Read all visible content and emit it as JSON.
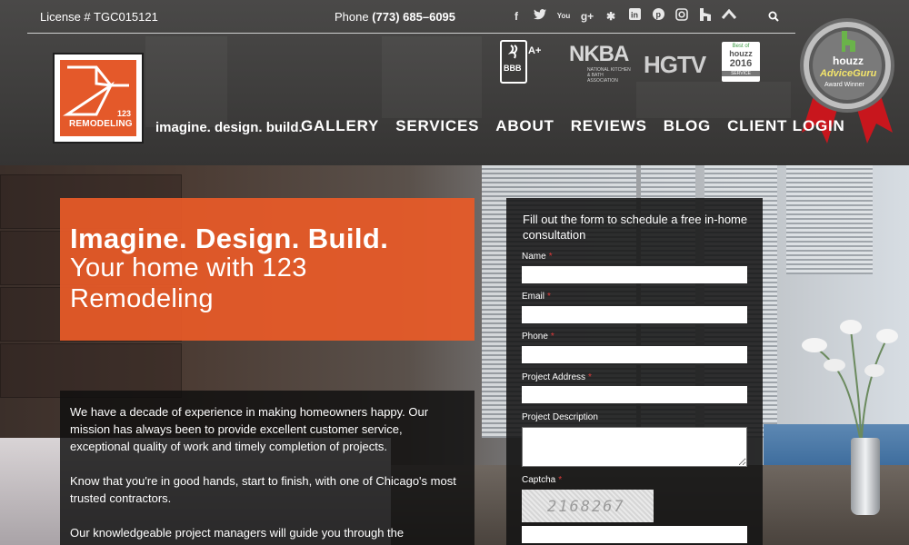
{
  "header": {
    "license": "License # TGC015121",
    "phone_label": "Phone",
    "phone_number": "(773) 685–6095",
    "social_icons": [
      "facebook-icon",
      "twitter-icon",
      "youtube-icon",
      "google-plus-icon",
      "yelp-icon",
      "linkedin-icon",
      "pinterest-icon",
      "instagram-icon",
      "houzz-icon",
      "angies-list-icon"
    ],
    "tagline": "imagine. design. build.",
    "logo": {
      "number": "123",
      "name": "REMODELING"
    },
    "nav": [
      "GALLERY",
      "SERVICES",
      "ABOUT",
      "REVIEWS",
      "BLOG",
      "CLIENT LOGIN"
    ],
    "badges": {
      "bbb": "BBB",
      "bbb_rating": "A+",
      "nkba": "NKBA",
      "nkba_sub": "NATIONAL KITCHEN & BATH ASSOCIATION",
      "hgtv": "HGTV",
      "houzz_best_of": "Best of",
      "houzz_brand": "houzz",
      "houzz_year": "2016",
      "houzz_service": "SERVICE"
    },
    "award": {
      "brand": "houzz",
      "title": "AdviceGuru",
      "subtitle": "Award Winner"
    }
  },
  "hero": {
    "headline_bold": "Imagine. Design. Build.",
    "headline_rest": "Your home with 123 Remodeling"
  },
  "about": {
    "p1": "We have a decade of experience in making homeowners happy. Our mission has always been to provide excellent customer service, exceptional quality of work and timely completion of projects.",
    "p2": "Know that you're in good hands, start to finish, with one of Chicago's most trusted contractors.",
    "p3": "Our knowledgeable project managers will guide you through the complicated process of remodeling your home."
  },
  "form": {
    "intro": "Fill out the form to schedule a free in-home consultation",
    "required_mark": "*",
    "fields": {
      "name": "Name",
      "email": "Email",
      "phone": "Phone",
      "project_address": "Project Address",
      "project_description": "Project Description",
      "captcha": "Captcha"
    },
    "captcha_code": "2168267"
  },
  "colors": {
    "accent": "#e85a28",
    "required": "#e03a3a"
  }
}
